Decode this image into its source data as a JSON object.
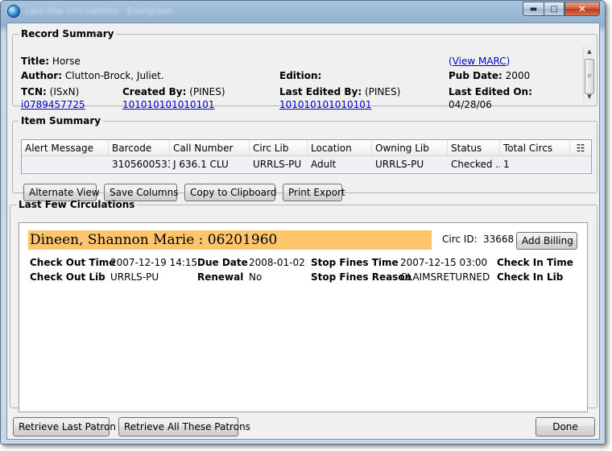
{
  "window": {
    "title": "Last Few Circulations - Evergreen"
  },
  "record_summary": {
    "legend": "Record Summary",
    "title_label": "Title:",
    "title_value": "Horse",
    "author_label": "Author:",
    "author_value": "Clutton-Brock, Juliet.",
    "edition_label": "Edition:",
    "view_marc_open": "(",
    "view_marc_link": "View MARC",
    "view_marc_close": ")",
    "pubdate_label": "Pub Date:",
    "pubdate_value": "2000",
    "tcn_label": "TCN:",
    "tcn_type": "(ISxN)",
    "tcn_value": "i0789457725",
    "created_label": "Created By:",
    "created_org": "(PINES)",
    "created_value": "101010101010101",
    "edited_label": "Last Edited By:",
    "edited_org": "(PINES)",
    "edited_value": "101010101010101",
    "edited_on_label": "Last Edited On:",
    "edited_on_value": "04/28/06"
  },
  "item_summary": {
    "legend": "Item Summary",
    "columns": [
      "Alert Message",
      "Barcode",
      "Call Number",
      "Circ Lib",
      "Location",
      "Owning Lib",
      "Status",
      "Total Circs"
    ],
    "rows": [
      [
        "",
        "3105600533...",
        "J 636.1 CLU",
        "URRLS-PU",
        "Adult",
        "URRLS-PU",
        "Checked ...",
        "1"
      ]
    ],
    "picker_icon": "column-picker-icon",
    "buttons": {
      "alternate_view": "Alternate View",
      "save_columns": "Save Columns",
      "copy_clipboard": "Copy to Clipboard",
      "print_export": "Print Export"
    }
  },
  "circulations": {
    "legend": "Last Few Circulations",
    "patron": "Dineen, Shannon Marie : 06201960",
    "circ_id_label": "Circ ID:",
    "circ_id_value": "33668",
    "add_billing": "Add Billing",
    "checkout_time_label": "Check Out Time",
    "checkout_time_value": "2007-12-19 14:15",
    "due_date_label": "Due Date",
    "due_date_value": "2008-01-02",
    "stop_fines_time_label": "Stop Fines Time",
    "stop_fines_time_value": "2007-12-15 03:00",
    "checkin_time_label": "Check In Time",
    "checkout_lib_label": "Check Out Lib",
    "checkout_lib_value": "URRLS-PU",
    "renewal_label": "Renewal",
    "renewal_value": "No",
    "stop_fines_reason_label": "Stop Fines Reason",
    "stop_fines_reason_value": "CLAIMSRETURNED",
    "checkin_lib_label": "Check In Lib"
  },
  "footer": {
    "retrieve_last": "Retrieve Last Patron",
    "retrieve_all": "Retrieve All These Patrons",
    "done": "Done"
  },
  "colors": {
    "patron_highlight": "#ffc56d",
    "link": "#0000cc",
    "title_bar": "#8fb0cf"
  }
}
